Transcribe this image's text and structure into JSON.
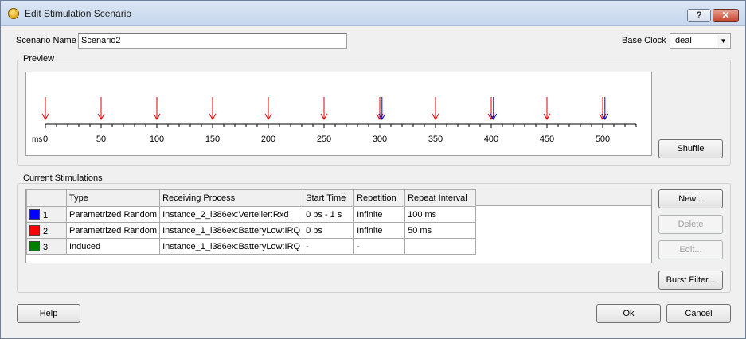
{
  "window": {
    "title": "Edit Stimulation Scenario",
    "help_btn": "?",
    "close_btn": "✕"
  },
  "scenario": {
    "label": "Scenario Name",
    "value": "Scenario2"
  },
  "base_clock": {
    "label": "Base Clock",
    "value": "Ideal"
  },
  "preview": {
    "title": "Preview",
    "unit": "ms",
    "ticks": [
      "0",
      "50",
      "100",
      "150",
      "200",
      "250",
      "300",
      "350",
      "400",
      "450",
      "500"
    ],
    "axis_max_ms": 530,
    "red_events_ms": [
      0,
      50,
      100,
      150,
      200,
      250,
      300,
      350,
      400,
      450,
      500
    ],
    "blue_events_ms": [
      302,
      402,
      502
    ],
    "colors": {
      "red": "#e00000",
      "blue": "#0000e0"
    }
  },
  "shuffle_btn": {
    "label": "Shuffle"
  },
  "stimulations": {
    "title": "Current Stimulations",
    "columns": [
      "Type",
      "Receiving Process",
      "Start Time",
      "Repetition",
      "Repeat Interval"
    ],
    "rows": [
      {
        "id": "1",
        "color": "#0000ff",
        "type": "Parametrized Random",
        "process": "Instance_2_i386ex:Verteiler:Rxd",
        "start": "0 ps - 1 s",
        "repetition": "Infinite",
        "interval": "100 ms"
      },
      {
        "id": "2",
        "color": "#ff0000",
        "type": "Parametrized Random",
        "process": "Instance_1_i386ex:BatteryLow:IRQ",
        "start": "0 ps",
        "repetition": "Infinite",
        "interval": "50 ms"
      },
      {
        "id": "3",
        "color": "#008000",
        "type": "Induced",
        "process": "Instance_1_i386ex:BatteryLow:IRQ",
        "start": "-",
        "repetition": "-",
        "interval": ""
      }
    ]
  },
  "buttons": {
    "new": "New...",
    "delete": "Delete",
    "edit": "Edit...",
    "burst": "Burst Filter...",
    "help": "Help",
    "ok": "Ok",
    "cancel": "Cancel"
  }
}
